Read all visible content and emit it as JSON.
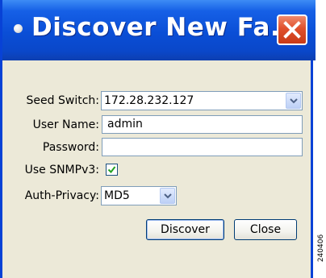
{
  "dialog": {
    "title": "Discover New Fa...",
    "colors": {
      "titlebar": "#0a4ed6",
      "close_button": "#e0502c",
      "body": "#ece9d8"
    }
  },
  "form": {
    "seed_switch": {
      "label": "Seed Switch:",
      "value": "172.28.232.127"
    },
    "user_name": {
      "label": "User Name:",
      "value": "admin"
    },
    "password": {
      "label": "Password:",
      "value": ""
    },
    "use_snmpv3": {
      "label": "Use SNMPv3:",
      "checked": true
    },
    "auth_privacy": {
      "label": "Auth-Privacy:",
      "value": "MD5"
    }
  },
  "buttons": {
    "discover": "Discover",
    "close": "Close"
  },
  "side_id": "240406",
  "icons": [
    "title-dot-icon",
    "close-x-icon",
    "chevron-down-icon",
    "checkmark-icon"
  ]
}
